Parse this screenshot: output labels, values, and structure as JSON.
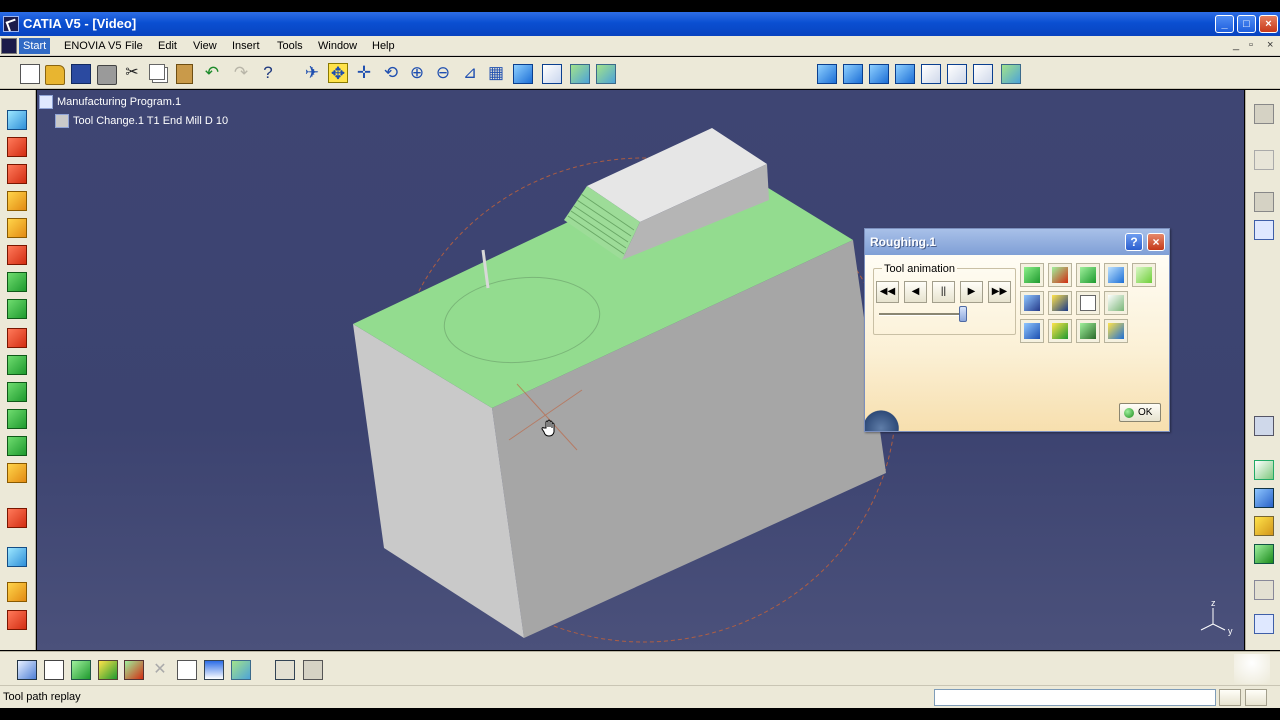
{
  "window": {
    "title": "CATIA V5 - [Video]",
    "controls": {
      "minimize": "_",
      "maximize": "□",
      "close": "×"
    }
  },
  "menubar": {
    "items": [
      "Start",
      "ENOVIA V5",
      "File",
      "Edit",
      "View",
      "Insert",
      "Tools",
      "Window",
      "Help"
    ],
    "mdi_controls": {
      "minimize": "_",
      "restore": "▫",
      "close": "×"
    }
  },
  "tree": {
    "root": "Manufacturing Program.1",
    "child": "Tool Change.1  T1 End Mill D 10"
  },
  "dialog": {
    "title": "Roughing.1",
    "help_label": "?",
    "close_label": "×",
    "group_label": "Tool animation",
    "controls": {
      "rewind": "◀◀",
      "step_back": "◀",
      "pause": "||",
      "play": "▶",
      "forward": "▶▶"
    },
    "slider_position": 0.95,
    "ok_label": "OK"
  },
  "viewport": {
    "axis_labels": {
      "z": "z",
      "y": "y"
    }
  },
  "statusbar": {
    "text": "Tool path replay",
    "command_value": ""
  },
  "colors": {
    "background": "#3e4573",
    "part_top": "#93dc8f",
    "part_side": "#a6a6a6",
    "part_front": "#c8c8c8",
    "titlebar": "#0a4fd1",
    "toolpath_circle": "#c0603a"
  }
}
